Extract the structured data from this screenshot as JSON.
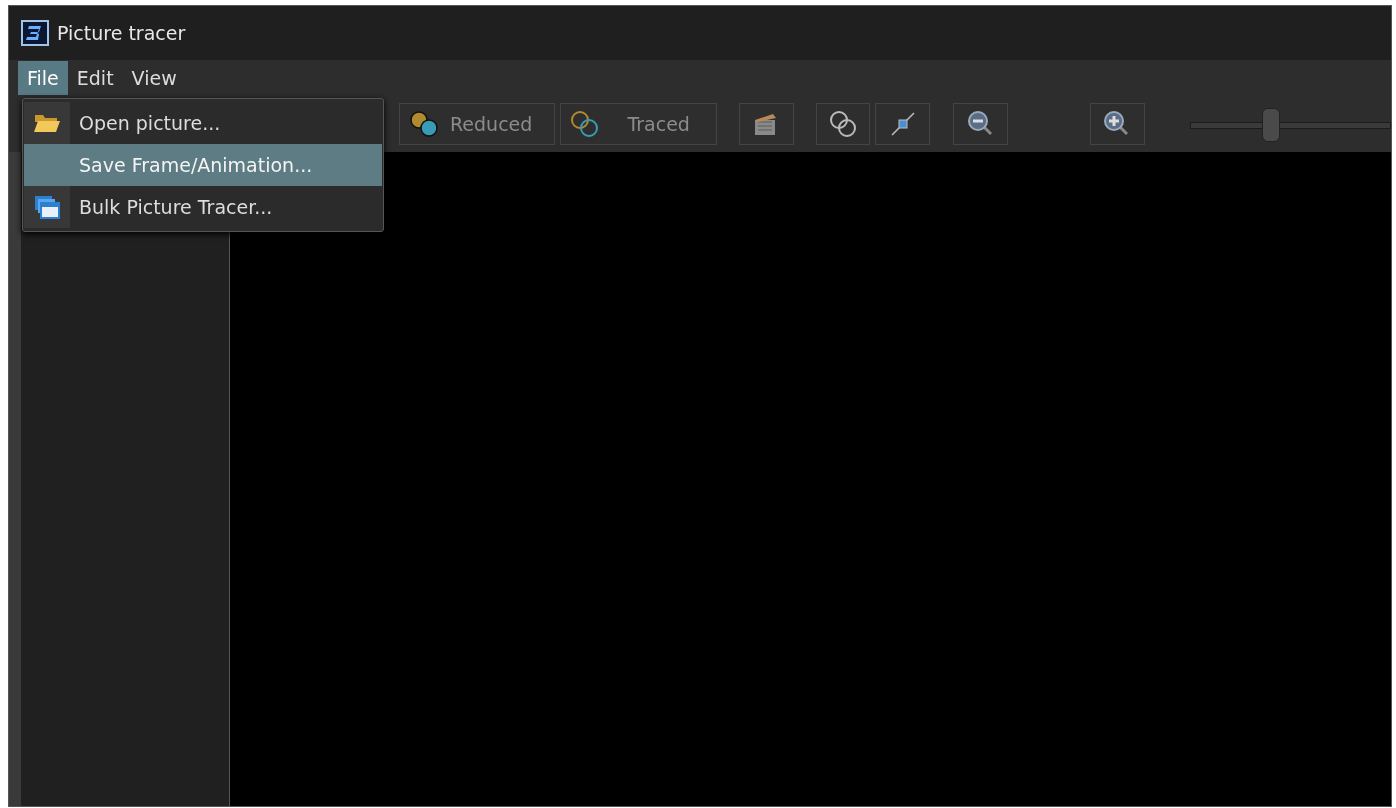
{
  "window": {
    "title": "Picture tracer"
  },
  "menu_bar": [
    {
      "label": "File",
      "selected": true
    },
    {
      "label": "Edit",
      "selected": false
    },
    {
      "label": "View",
      "selected": false
    }
  ],
  "file_menu": [
    {
      "label": "Open picture...",
      "selected": false
    },
    {
      "label": "Save Frame/Animation...",
      "selected": true
    },
    {
      "label": "Bulk Picture Tracer...",
      "selected": false
    }
  ],
  "toolbar": [
    {
      "kind": "mode",
      "label": "Reduced"
    },
    {
      "kind": "mode",
      "label": "Traced"
    },
    {
      "kind": "tool"
    },
    {
      "kind": "tool"
    },
    {
      "kind": "tool"
    },
    {
      "kind": "zoom"
    },
    {
      "kind": "zoom"
    }
  ],
  "zoom_slider": {
    "level": 0.4
  }
}
